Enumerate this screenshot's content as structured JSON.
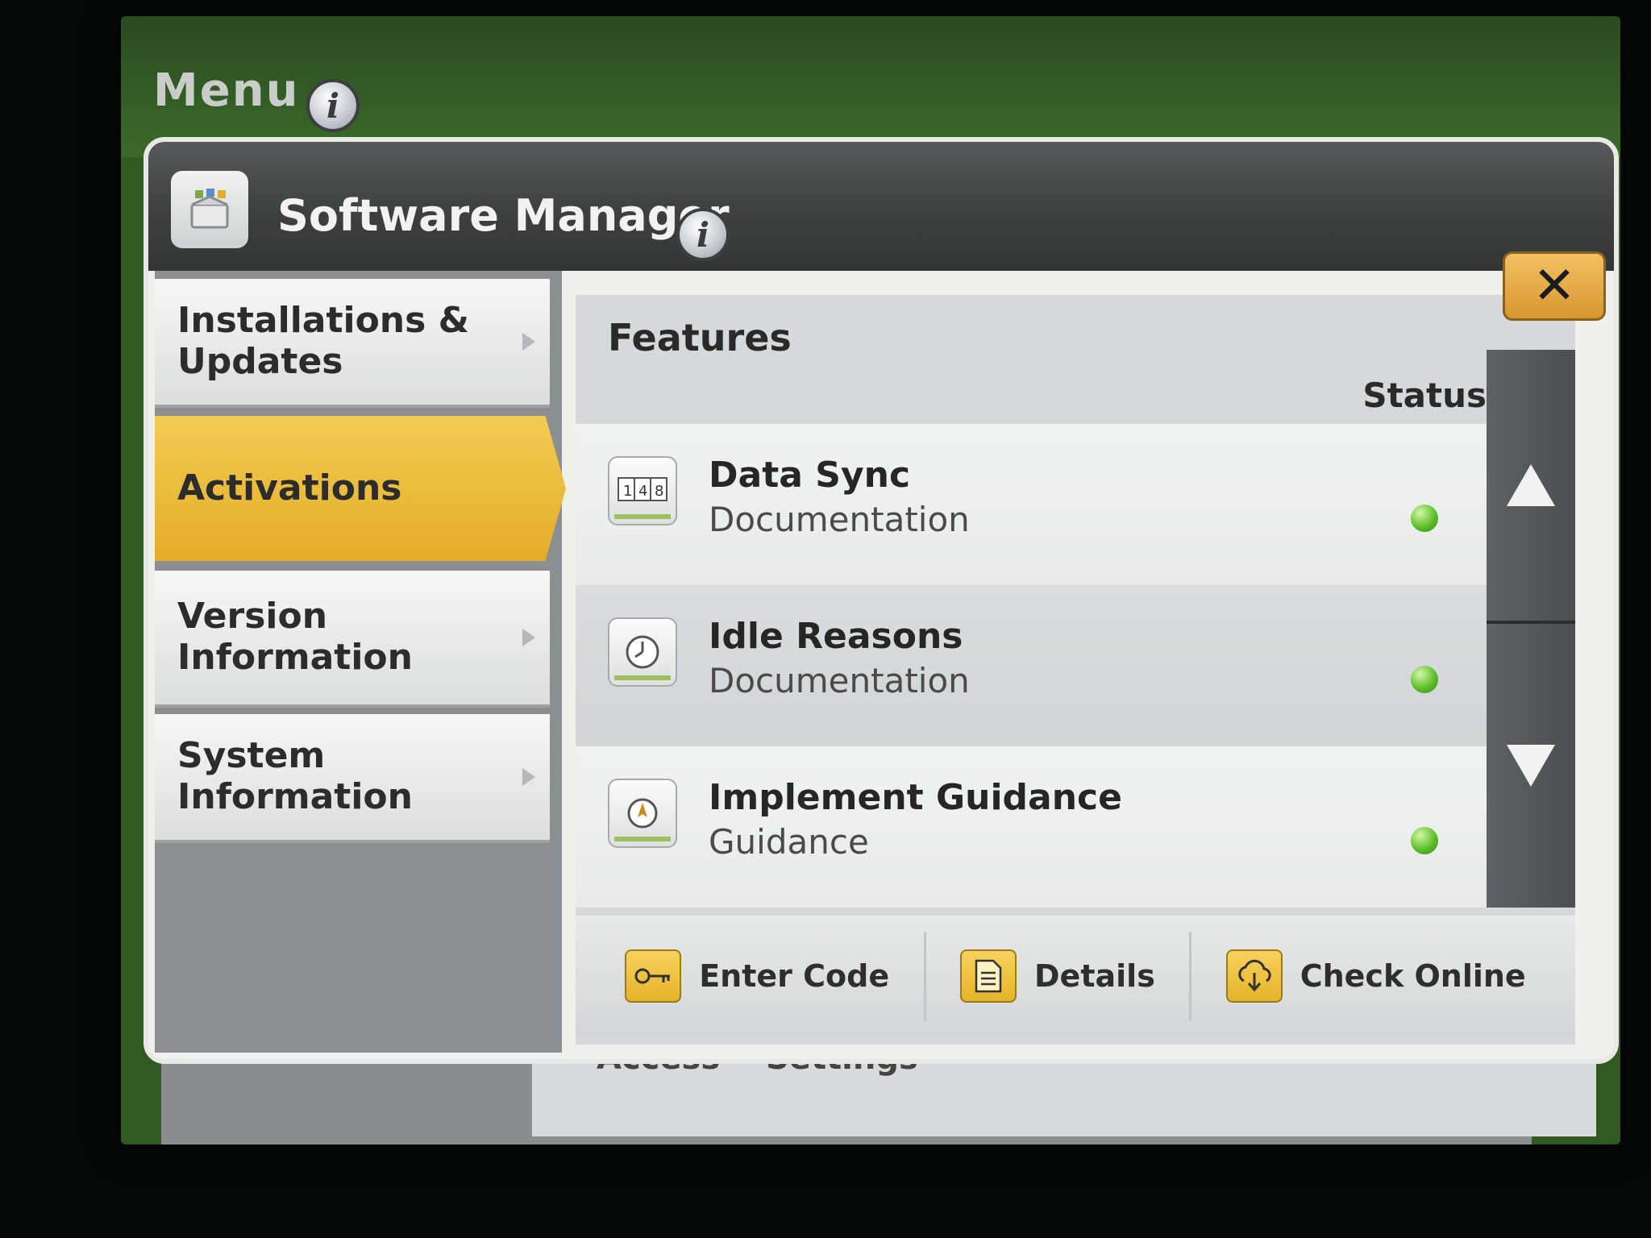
{
  "menu": {
    "title": "Menu"
  },
  "dialog": {
    "title": "Software Manager"
  },
  "sidebar": {
    "items": [
      {
        "label_line1": "Installations &",
        "label_line2": "Updates"
      },
      {
        "label": "Activations"
      },
      {
        "label_line1": "Version",
        "label_line2": "Information"
      },
      {
        "label_line1": "System",
        "label_line2": "Information"
      }
    ]
  },
  "content": {
    "header": "Features",
    "status_header": "Status",
    "features": [
      {
        "name": "Data Sync",
        "category": "Documentation",
        "icon": "counter-icon",
        "status_color": "#5fbf2b"
      },
      {
        "name": "Idle Reasons",
        "category": "Documentation",
        "icon": "clock-icon",
        "status_color": "#5fbf2b"
      },
      {
        "name": "Implement Guidance",
        "category": "Guidance",
        "icon": "compass-icon",
        "status_color": "#5fbf2b"
      }
    ],
    "buttons": {
      "enter_code": "Enter Code",
      "details": "Details",
      "check_online": "Check Online"
    }
  },
  "background": {
    "partial_left": "Access",
    "partial_right": "Settings"
  },
  "colors": {
    "accent_yellow": "#e3ad28",
    "status_green": "#5fbf2b",
    "bezel_green": "#2f5a22"
  }
}
